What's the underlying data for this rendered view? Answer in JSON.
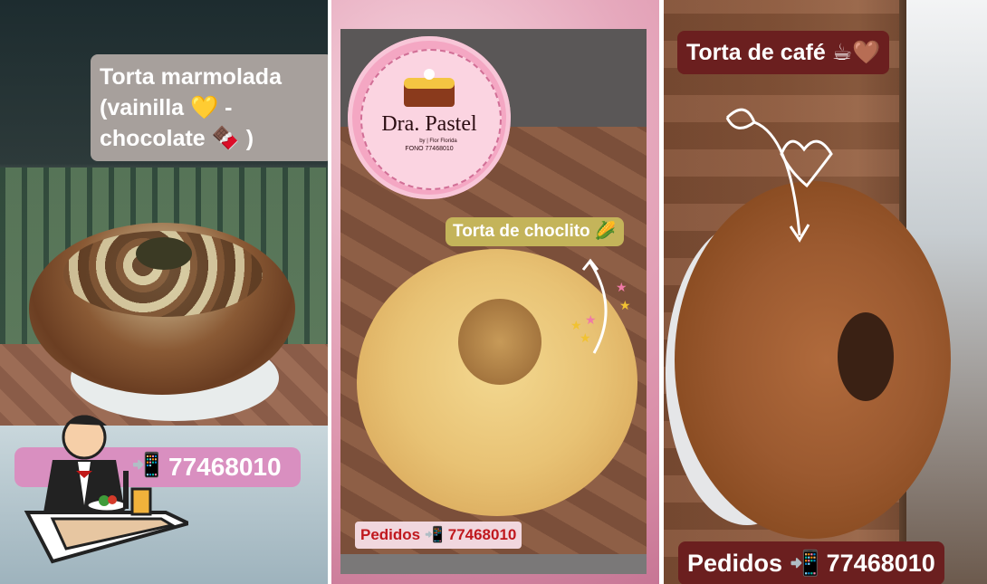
{
  "panel_left": {
    "caption": "Torta marmolada\n(vainilla 💛 -\nchocolate 🍫 )",
    "orders": "77468010",
    "phone_glyph": "📲",
    "dining_icon": "dining-icon"
  },
  "panel_middle": {
    "logo_title": "Dra. Pastel",
    "logo_by": "by | Flor Florida",
    "logo_phone": "FONO 77468010",
    "caption": "Torta de choclito 🌽",
    "orders": "Pedidos 📲 77468010"
  },
  "panel_right": {
    "caption": "Torta de café ☕🤎",
    "orders": "Pedidos 📲 77468010"
  },
  "colors": {
    "caption_dark": "#6b1f1f",
    "caption_gray": "#a29a96",
    "orders_pink": "#e09ac4",
    "logo_pink": "#f4a7c3"
  }
}
